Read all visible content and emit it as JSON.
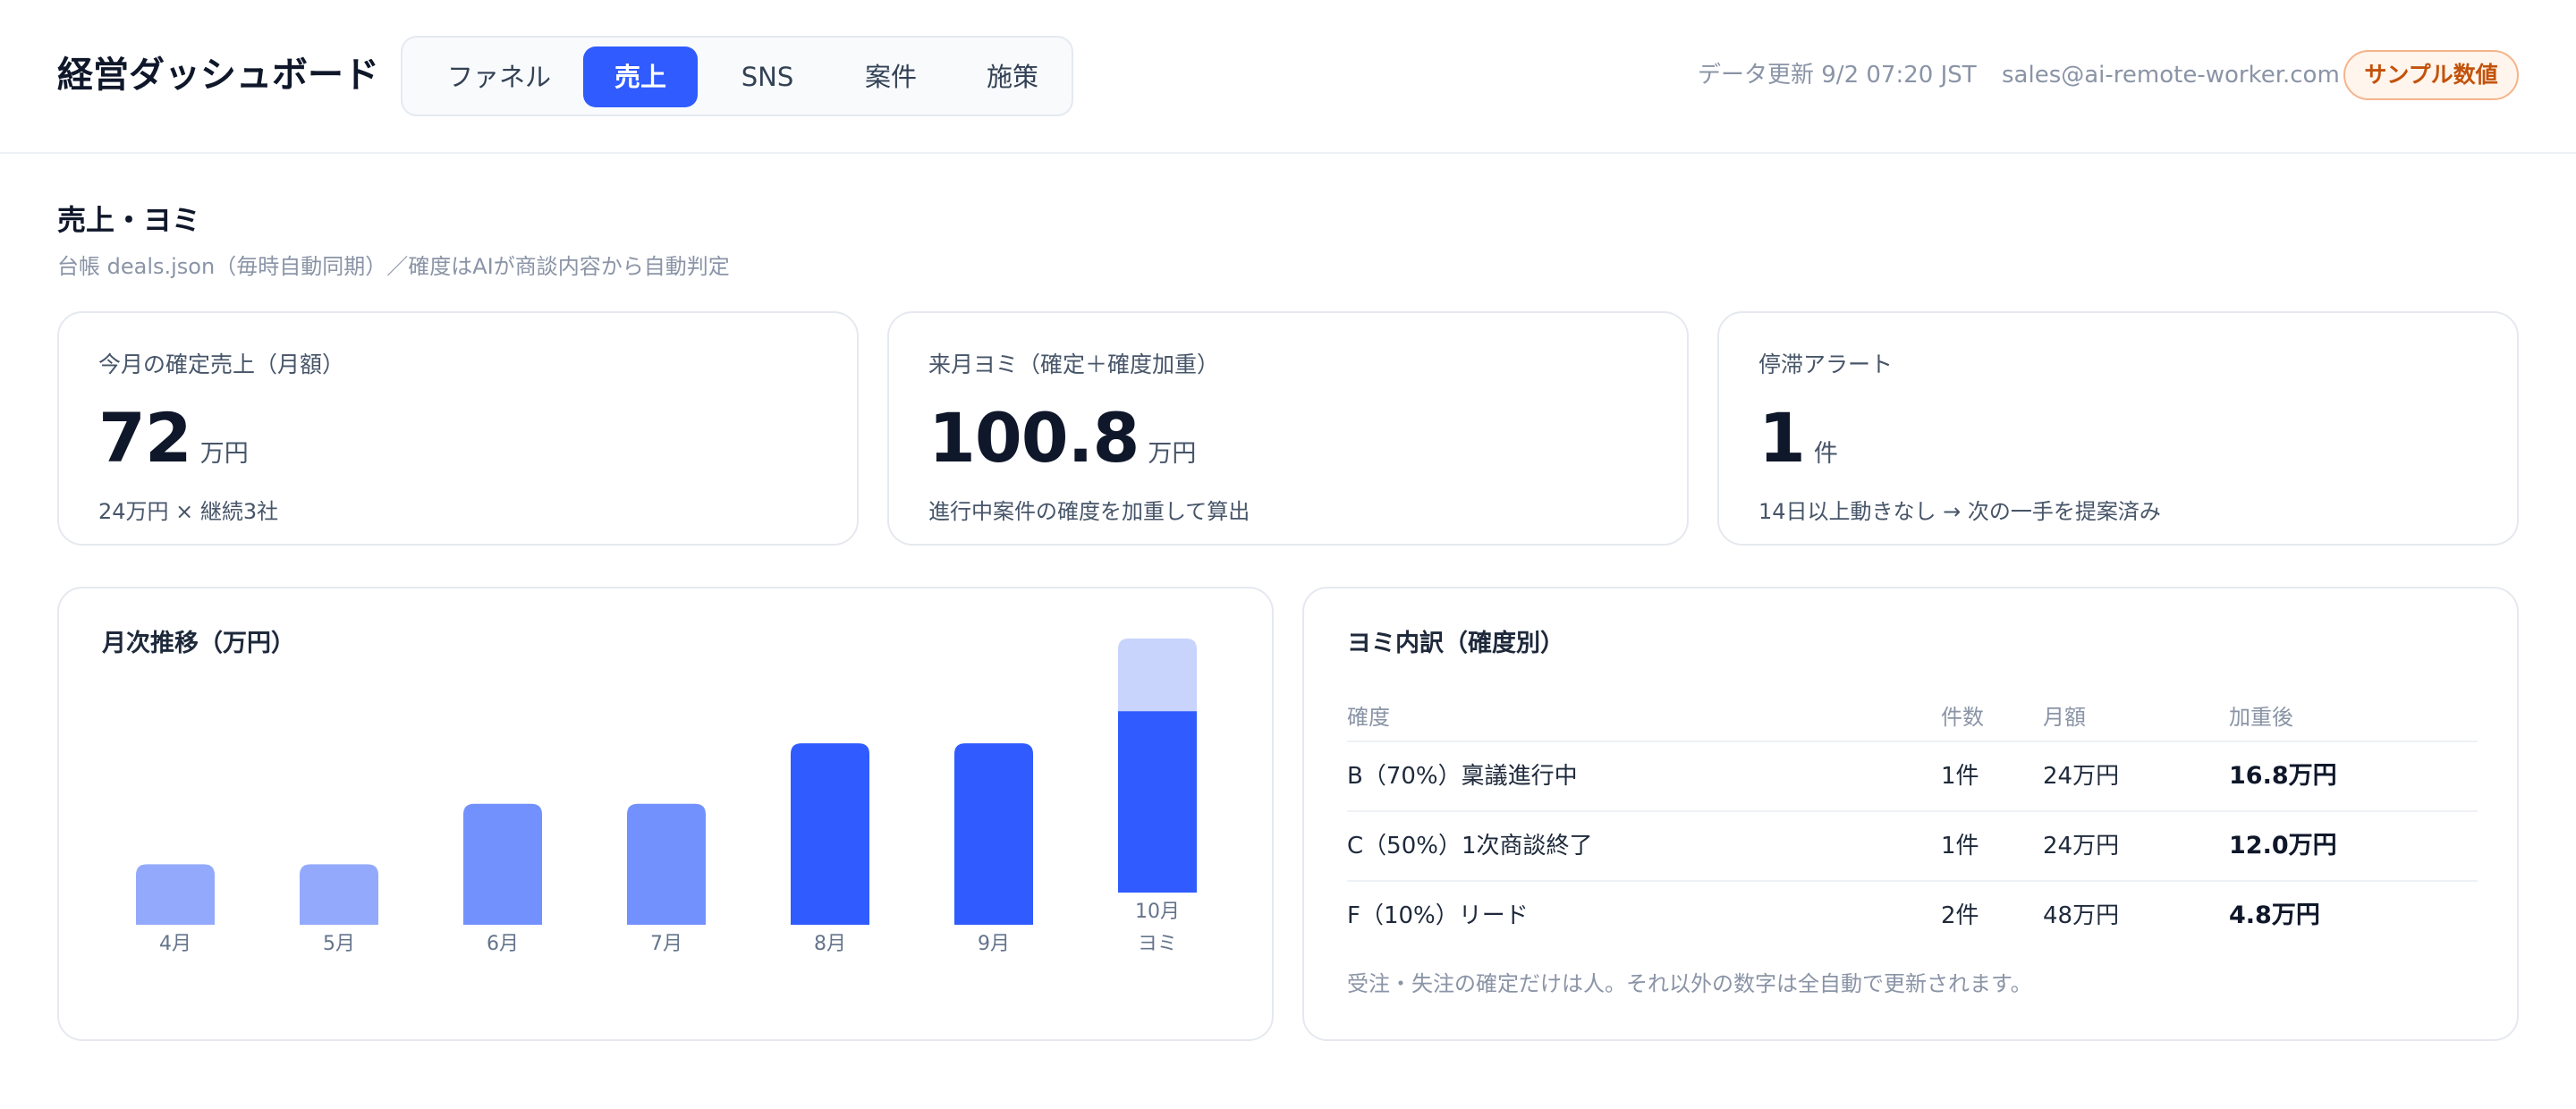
{
  "header": {
    "title": "経営ダッシュボード",
    "tabs": [
      {
        "label": "ファネル",
        "active": false
      },
      {
        "label": "売上",
        "active": true
      },
      {
        "label": "SNS",
        "active": false
      },
      {
        "label": "案件",
        "active": false
      },
      {
        "label": "施策",
        "active": false
      }
    ],
    "updated": "データ更新 9/2 07:20 JST",
    "email": "sales@ai-remote-worker.com",
    "badge": "サンプル数値"
  },
  "section": {
    "title": "売上・ヨミ",
    "subtitle": "台帳 deals.json（毎時自動同期）／確度はAIが商談内容から自動判定"
  },
  "kpis": [
    {
      "label": "今月の確定売上（月額）",
      "value": "72",
      "unit": "万円",
      "note": "24万円 × 継続3社"
    },
    {
      "label": "来月ヨミ（確定＋確度加重）",
      "value": "100.8",
      "unit": "万円",
      "note": "進行中案件の確度を加重して算出"
    },
    {
      "label": "停滞アラート",
      "value": "1",
      "unit": "件",
      "note": "14日以上動きなし → 次の一手を提案済み"
    }
  ],
  "chart": {
    "title": "月次推移（万円）"
  },
  "chart_data": {
    "type": "bar",
    "categories": [
      "4月",
      "5月",
      "6月",
      "7月",
      "8月",
      "9月",
      "10月\nヨミ"
    ],
    "series": [
      {
        "values": [
          24,
          24,
          48,
          48,
          72,
          72,
          72
        ]
      },
      {
        "values": [
          0,
          0,
          0,
          0,
          0,
          0,
          28.8
        ]
      }
    ],
    "colors": [
      "#93aafc",
      "#93aafc",
      "#7391fd",
      "#7391fd",
      "#2f5bff",
      "#2f5bff",
      "#2f5bff"
    ],
    "overlay_color": "#c8d4fc",
    "ylim": [
      0,
      110
    ],
    "grid": false,
    "legend": "none"
  },
  "breakdown": {
    "title": "ヨミ内訳（確度別）",
    "headers": [
      "確度",
      "件数",
      "月額",
      "加重後"
    ],
    "rows": [
      [
        "B（70%）稟議進行中",
        "1件",
        "24万円",
        "16.8万円"
      ],
      [
        "C（50%）1次商談終了",
        "1件",
        "24万円",
        "12.0万円"
      ],
      [
        "F（10%）リード",
        "2件",
        "48万円",
        "4.8万円"
      ]
    ],
    "note": "受注・失注の確定だけは人。それ以外の数字は全自動で更新されます。"
  }
}
